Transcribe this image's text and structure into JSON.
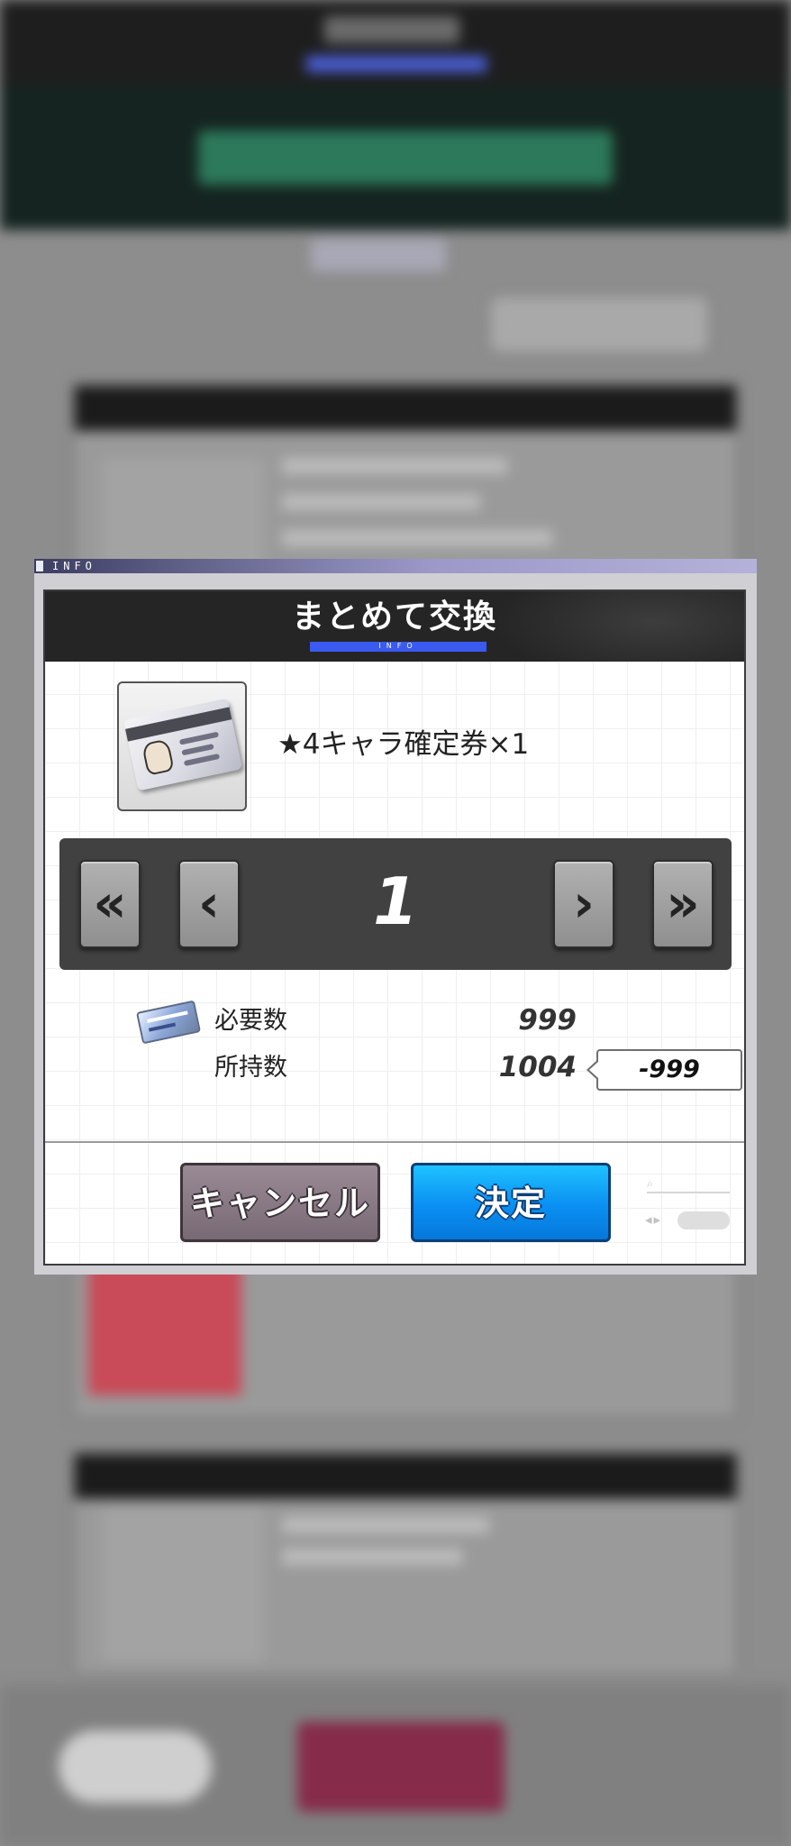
{
  "info_strip": {
    "label": "INFO"
  },
  "dialog": {
    "title": "まとめて交換",
    "title_sublabel": "INFO",
    "item": {
      "name": "★4キャラ確定券×1"
    },
    "stepper": {
      "quantity": "1",
      "first_label": "«",
      "prev_label": "‹",
      "next_label": "›",
      "last_label": "»"
    },
    "cost": {
      "required_label": "必要数",
      "required_value": "999",
      "owned_label": "所持数",
      "owned_value": "1004",
      "diff_value": "-999"
    },
    "buttons": {
      "cancel_label": "キャンセル",
      "confirm_label": "決定"
    }
  },
  "colors": {
    "confirm": "#0a8ff2",
    "cancel": "#8a7a86",
    "header": "#252525",
    "accent_bar": "#3b5af0"
  }
}
